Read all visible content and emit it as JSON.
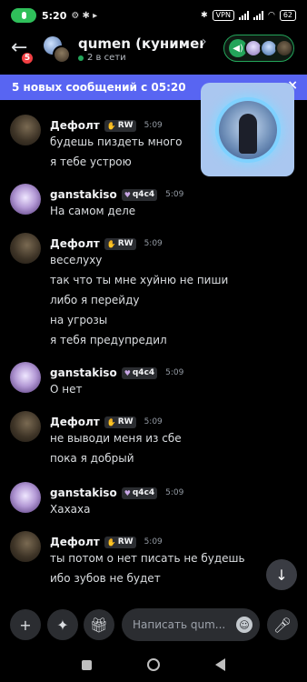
{
  "status_bar": {
    "time": "5:20",
    "icons_left": "⚙ ✱ ▸",
    "vpn": "VPN",
    "battery": "62"
  },
  "header": {
    "back_badge": "5",
    "title": "qumen (кунимен...",
    "chevron": "›",
    "subtitle": "2 в сети"
  },
  "new_messages_bar": {
    "text": "5 новых сообщений с 05:20",
    "close": "×"
  },
  "messages": [
    {
      "author": "Дефолт",
      "tag": "RW",
      "time": "5:09",
      "lines": [
        "будешь пиздеть много",
        "я тебе устрою"
      ]
    },
    {
      "author": "ganstakiso",
      "tag": "q4c4",
      "time": "5:09",
      "lines": [
        "На самом деле"
      ]
    },
    {
      "author": "Дефолт",
      "tag": "RW",
      "time": "5:09",
      "lines": [
        "веселуху",
        "так что ты мне хуйню не пиши",
        "либо я перейду",
        "на угрозы",
        "я тебя предупредил"
      ]
    },
    {
      "author": "ganstakiso",
      "tag": "q4c4",
      "time": "5:09",
      "lines": [
        "О нет"
      ]
    },
    {
      "author": "Дефолт",
      "tag": "RW",
      "time": "5:09",
      "lines": [
        "не выводи меня из сбе",
        "пока я добрый"
      ]
    },
    {
      "author": "ganstakiso",
      "tag": "q4c4",
      "time": "5:09",
      "lines": [
        "Хахаха"
      ]
    },
    {
      "author": "Дефолт",
      "tag": "RW",
      "time": "5:09",
      "lines": [
        "ты потом о нет писать не будешь",
        "ибо зубов не будет"
      ]
    }
  ],
  "composer": {
    "placeholder": "Написать qum..."
  },
  "icons": {
    "back": "arrow-left-icon",
    "scroll_down": "arrow-down-icon",
    "add": "plus-icon",
    "apps": "apps-icon",
    "gift": "gift-icon",
    "emoji": "smile-icon",
    "mic": "mic-icon"
  },
  "colors": {
    "accent": "#5865f2",
    "online": "#23a55a",
    "badge": "#f23f43",
    "background": "#000000"
  }
}
